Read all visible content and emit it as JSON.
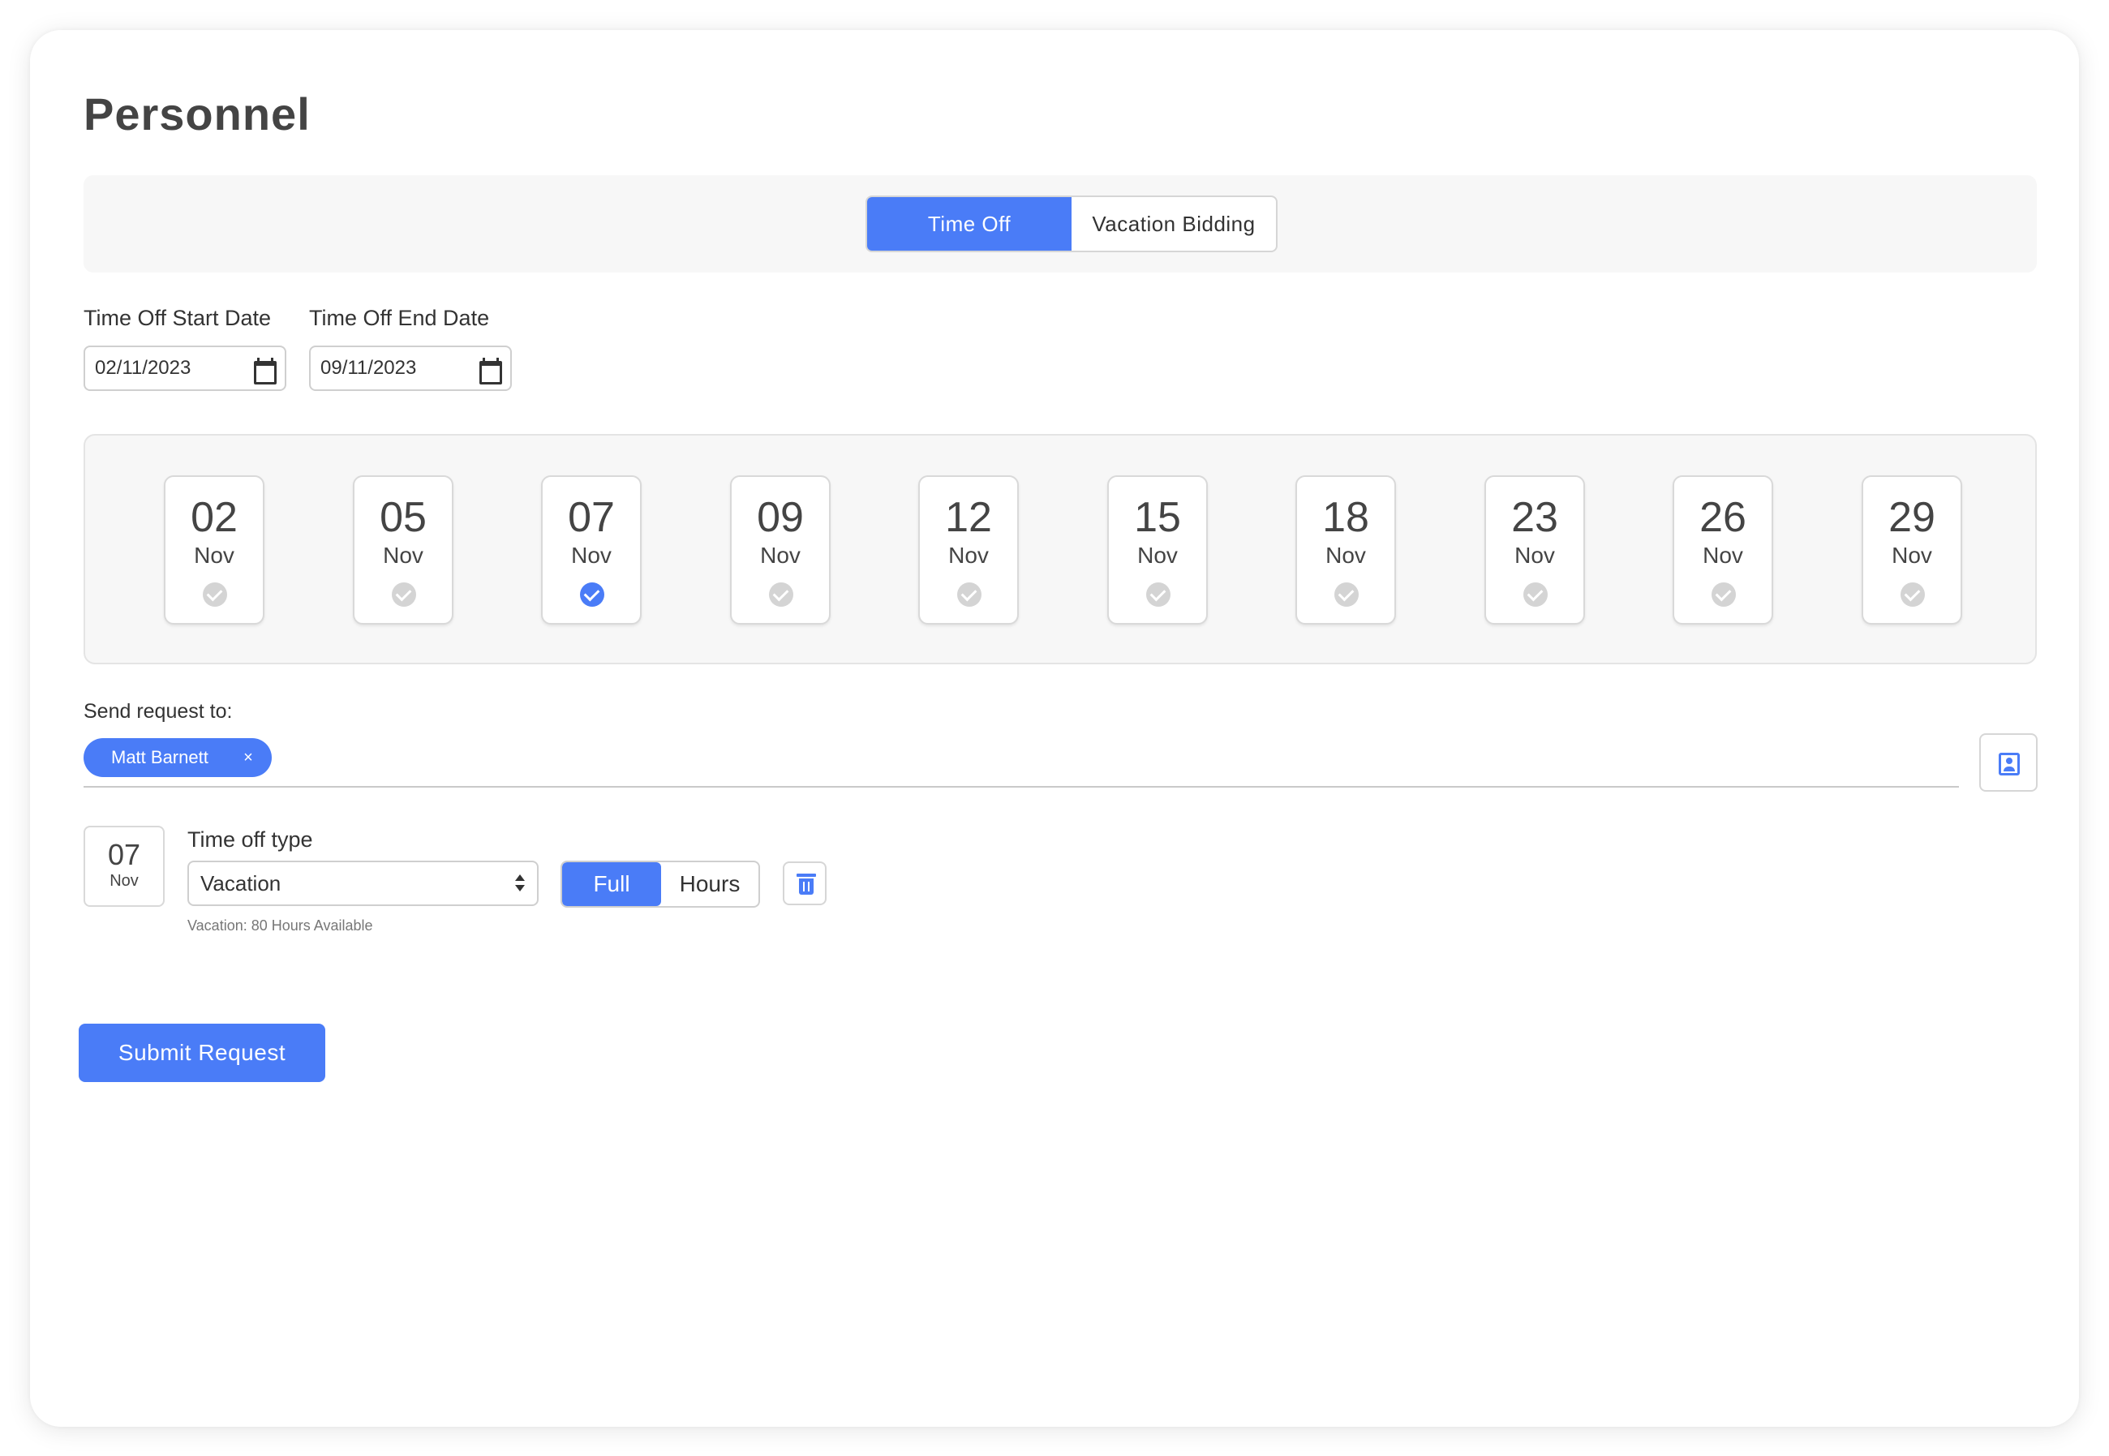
{
  "page": {
    "title": "Personnel"
  },
  "tabs": [
    {
      "label": "Time Off",
      "active": true
    },
    {
      "label": "Vacation Bidding",
      "active": false
    }
  ],
  "dates": {
    "start_label": "Time Off Start Date",
    "start_value": "02/11/2023",
    "end_label": "Time Off End Date",
    "end_value": "09/11/2023"
  },
  "day_cards": [
    {
      "day": "02",
      "month": "Nov",
      "selected": false
    },
    {
      "day": "05",
      "month": "Nov",
      "selected": false
    },
    {
      "day": "07",
      "month": "Nov",
      "selected": true
    },
    {
      "day": "09",
      "month": "Nov",
      "selected": false
    },
    {
      "day": "12",
      "month": "Nov",
      "selected": false
    },
    {
      "day": "15",
      "month": "Nov",
      "selected": false
    },
    {
      "day": "18",
      "month": "Nov",
      "selected": false
    },
    {
      "day": "23",
      "month": "Nov",
      "selected": false
    },
    {
      "day": "26",
      "month": "Nov",
      "selected": false
    },
    {
      "day": "29",
      "month": "Nov",
      "selected": false
    }
  ],
  "send_request": {
    "label": "Send request to:",
    "recipients": [
      {
        "name": "Matt Barnett",
        "remove": "×"
      }
    ]
  },
  "entry": {
    "day": "07",
    "month": "Nov",
    "type_label": "Time off type",
    "type_value": "Vacation",
    "availability": "Vacation: 80 Hours Available",
    "duration_options": [
      "Full",
      "Hours"
    ],
    "duration_selected": "Full"
  },
  "submit_label": "Submit Request",
  "colors": {
    "accent": "#4a7cf7",
    "check_inactive": "#d4d4d4",
    "panel_bg": "#f7f7f7"
  },
  "icons": [
    "calendar-icon",
    "check-circle-icon",
    "contacts-icon",
    "trash-icon",
    "select-arrows-icon",
    "close-icon"
  ]
}
